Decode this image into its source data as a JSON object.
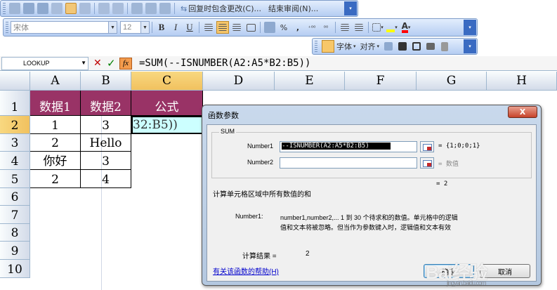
{
  "toolbar_review": {
    "reply_label": "回复时包含更改(C)...",
    "end_review_label": "结束审阅(N)..."
  },
  "toolbar_format": {
    "font_name": "宋体",
    "font_size": "12",
    "bold": "B",
    "italic": "I",
    "underline": "U",
    "percent": "%",
    "comma": ",",
    "font_color_letter": "A"
  },
  "toolbar_extra": {
    "font_label": "字体",
    "align_label": "对齐"
  },
  "formula_bar": {
    "name_box": "LOOKUP",
    "cancel_symbol": "✕",
    "enter_symbol": "✓",
    "fx_symbol": "fx",
    "formula": "=SUM(--ISNUMBER(A2:A5*B2:B5))"
  },
  "sheet": {
    "columns": [
      "A",
      "B",
      "C",
      "D",
      "E",
      "F",
      "G",
      "H"
    ],
    "rows": [
      "1",
      "2",
      "3",
      "4",
      "5",
      "6",
      "7",
      "8",
      "9",
      "10"
    ],
    "selected_column": "C",
    "selected_row": "2",
    "cells": {
      "A1": "数据1",
      "B1": "数据2",
      "C1": "公式",
      "A2": "1",
      "B2": "3",
      "C2": "32:B5))",
      "A3": "2",
      "B3": "Hello",
      "A4": "你好",
      "B4": "3",
      "A5": "2",
      "B5": "4"
    },
    "header_fill_color": "#993366",
    "active_cell_color": "#ccffff"
  },
  "dialog": {
    "title": "函数参数",
    "close_label": "X",
    "function_name": "SUM",
    "arg1_label": "Number1",
    "arg1_value": "--ISNUMBER(A2:A5*B2:B5)",
    "arg1_result": "= {1;0;0;1}",
    "arg2_label": "Number2",
    "arg2_result": "= 数值",
    "function_result": "= 2",
    "description": "计算单元格区域中所有数值的和",
    "arg_help_name": "Number1:",
    "arg_help_line1": "number1,number2,... 1 到 30 个待求和的数值。单元格中的逻辑",
    "arg_help_line2": "值和文本将被忽略。但当作为参数键入时，逻辑值和文本有效",
    "calc_result_label": "计算结果 =",
    "calc_result_value": "2",
    "help_link": "有关该函数的帮助(H)",
    "ok_label": "确定",
    "cancel_label": "取消"
  },
  "watermark": {
    "brand": "Bai经验",
    "url": "jingyan.baidu.com"
  }
}
